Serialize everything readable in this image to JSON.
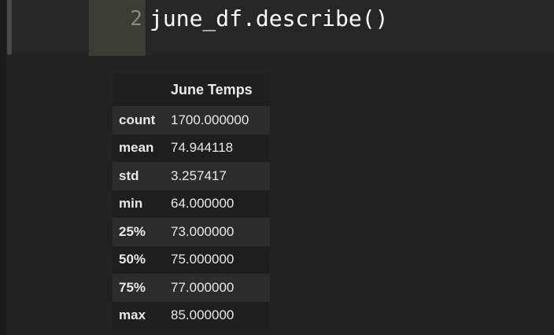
{
  "code_cell": {
    "line_number": "2",
    "code": "june_df.describe()"
  },
  "dataframe": {
    "columns": [
      "June Temps"
    ],
    "rows": [
      {
        "index": "count",
        "value": "1700.000000"
      },
      {
        "index": "mean",
        "value": "74.944118"
      },
      {
        "index": "std",
        "value": "3.257417"
      },
      {
        "index": "min",
        "value": "64.000000"
      },
      {
        "index": "25%",
        "value": "73.000000"
      },
      {
        "index": "50%",
        "value": "75.000000"
      },
      {
        "index": "75%",
        "value": "77.000000"
      },
      {
        "index": "max",
        "value": "85.000000"
      }
    ]
  },
  "colors": {
    "background": "#222222",
    "gutter": "#3b3d35",
    "code_text": "#ffffff",
    "line_number": "#8a8a80"
  }
}
